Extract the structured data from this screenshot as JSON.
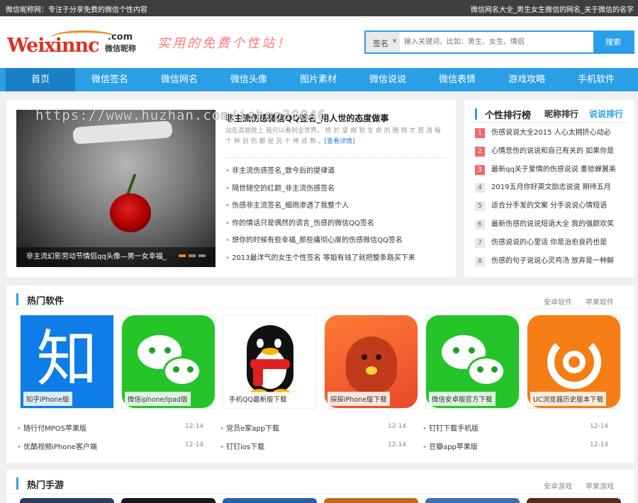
{
  "topbar": {
    "left": "微信昵称网：专注于分享免费的微信个性内容",
    "right": "微信网名大全_男生女生微信的网名_关于微信的名字"
  },
  "logo": {
    "main": "Weixinnc",
    "com": ".com",
    "cn": "微信昵称"
  },
  "slogan": "实用的免费个性站！",
  "search": {
    "category": "签名",
    "placeholder": "输入关键词，比如：男生、女生、情侣",
    "button": "搜索"
  },
  "nav": [
    "首页",
    "微信签名",
    "微信网名",
    "微信头像",
    "图片素材",
    "微信说说",
    "微信表情",
    "游戏攻略",
    "手机软件"
  ],
  "watermark": "https://www.huzhan.com/ishop30046",
  "hero": {
    "caption": "非主流幻影劳动节情侣qq头像—男一女幸福_"
  },
  "headline": "非主流伤感微信QQ签名_用人世的态度做事",
  "summary": "站在高丽胜上 我可以看到全世界。 终 於 拿 捐 到 生 命 的 贿 赂 才 若 清 每 个 种 剑 伤 都 是 另 个 神 成 熟 。",
  "summary_more": "[查看详情]",
  "articles": [
    "非主流伤感签名_致今后的提律道",
    "隔世随空的红颜_非主流伤感签名",
    "伤感非主流签名_细雨渗透了我整个人",
    "你的情话只是偶然的谎言_伤感的微信QQ签名",
    "想你的时候有些幸福_那些痛彻心扉的伤感微信QQ签名",
    "2013最洋气的女生个性签名 等姐有钱了就把整条路买下来"
  ],
  "ranking": {
    "title": "个性排行榜",
    "tab1": "昵称排行",
    "tab2": "说说排行",
    "items": [
      {
        "n": "1",
        "t": "伤感说说大全2015 人心太拥挤心动必"
      },
      {
        "n": "2",
        "t": "心情悲伤的说说和自己有关的 如果你是"
      },
      {
        "n": "3",
        "t": "最新qq关于爱情的伤感说说 重拾蝉翼美"
      },
      {
        "n": "4",
        "t": "2019五月你好英文励志说说 期待五月"
      },
      {
        "n": "5",
        "t": "适合分手发的文案 分手说说心情短语"
      },
      {
        "n": "6",
        "t": "最新伤感的说说短语大全 我的强颜欢笑"
      },
      {
        "n": "7",
        "t": "伤感说说的心里话 你是治愈良药也是"
      },
      {
        "n": "8",
        "t": "伤感的句子说说心灵鸡汤 放弃是一种解"
      }
    ]
  },
  "software": {
    "title": "热门软件",
    "tab1": "安卓软件",
    "tab2": "苹果软件",
    "apps": [
      {
        "label": "知乎iPhone版",
        "glyph": "知"
      },
      {
        "label": "微信iphone/ipad版"
      },
      {
        "label": "手机QQ最新版下载"
      },
      {
        "label": "探探iPhone版下载"
      },
      {
        "label": "微信安卓版官方下载"
      },
      {
        "label": "UC浏览器历史版本下载"
      }
    ],
    "links": [
      {
        "t": "随行付MPOS苹果版",
        "d": "12-14"
      },
      {
        "t": "党员e家app下载",
        "d": "12-14"
      },
      {
        "t": "钉钉下载手机版",
        "d": "12-14"
      },
      {
        "t": "优酷视频iPhone客户端",
        "d": "12-14"
      },
      {
        "t": "钉钉ios下载",
        "d": "12-14"
      },
      {
        "t": "豆瓣app苹果版",
        "d": "12-14"
      }
    ]
  },
  "games": {
    "title": "热门手游",
    "tab1": "安卓游戏",
    "tab2": "苹果游戏"
  }
}
